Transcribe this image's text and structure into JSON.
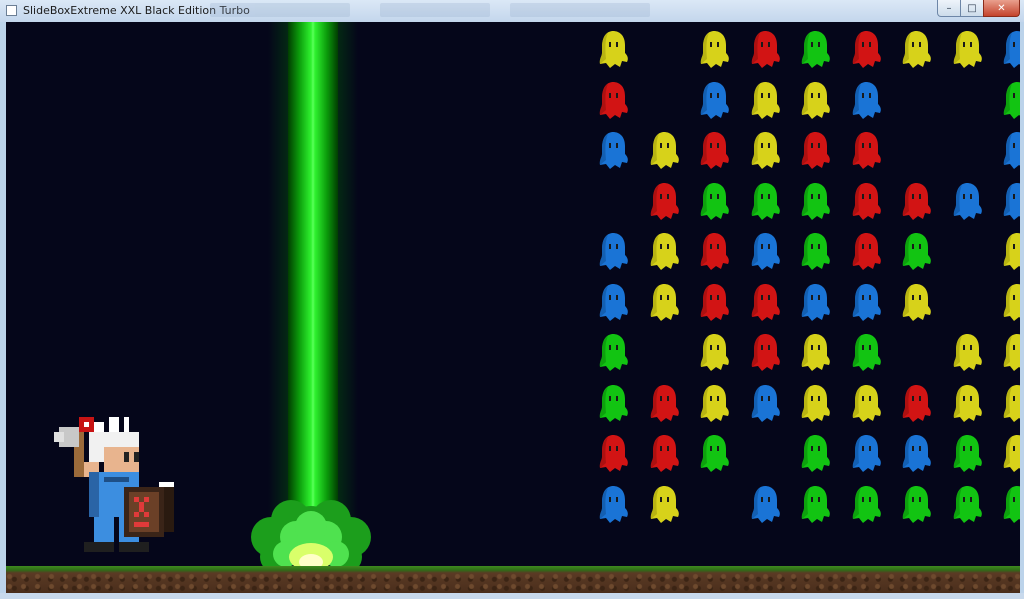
{
  "window": {
    "title": "SlideBoxExtreme XXL Black Edition Turbo",
    "minimize_label": "–",
    "maximize_label": "□",
    "close_label": "✕"
  },
  "palette": {
    "yellow": "#d7d21a",
    "red": "#d21414",
    "green": "#12c412",
    "blue": "#1a74d6",
    "background": "#05061a",
    "beam": "#2ff22f"
  },
  "ghost_grid": [
    [
      "yellow",
      null,
      "yellow",
      "red",
      "green",
      "red",
      "yellow",
      "yellow",
      "blue"
    ],
    [
      "red",
      null,
      "blue",
      "yellow",
      "yellow",
      "blue",
      null,
      null,
      "green"
    ],
    [
      "blue",
      "yellow",
      "red",
      "yellow",
      "red",
      "red",
      null,
      null,
      "blue"
    ],
    [
      null,
      "red",
      "green",
      "green",
      "green",
      "red",
      "red",
      "blue",
      "blue"
    ],
    [
      "blue",
      "yellow",
      "red",
      "blue",
      "green",
      "red",
      "green",
      null,
      "yellow"
    ],
    [
      "blue",
      "yellow",
      "red",
      "red",
      "blue",
      "blue",
      "yellow",
      null,
      "yellow"
    ],
    [
      "green",
      null,
      "yellow",
      "red",
      "yellow",
      "green",
      null,
      "yellow",
      "yellow"
    ],
    [
      "green",
      "red",
      "yellow",
      "blue",
      "yellow",
      "yellow",
      "red",
      "yellow",
      "yellow"
    ],
    [
      "red",
      "red",
      "green",
      null,
      "green",
      "blue",
      "blue",
      "green",
      "yellow"
    ],
    [
      "blue",
      "yellow",
      null,
      "blue",
      "green",
      "green",
      "green",
      "green",
      "green"
    ]
  ],
  "sprites": {
    "player": "knight-player-sprite",
    "laser": "green-laser-beam",
    "ground": "grass-dirt-floor"
  }
}
